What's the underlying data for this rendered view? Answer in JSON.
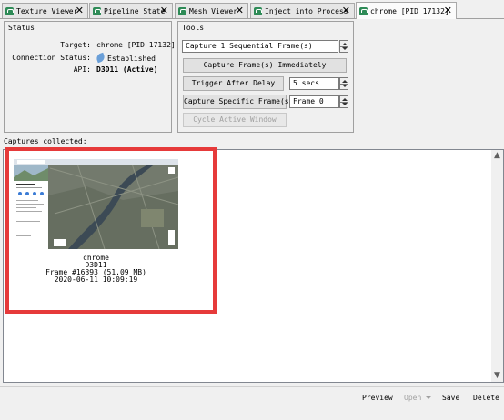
{
  "tabs": [
    {
      "label": "Texture Viewer",
      "active": false
    },
    {
      "label": "Pipeline State",
      "active": false
    },
    {
      "label": "Mesh Viewer",
      "active": false
    },
    {
      "label": "Inject into Process",
      "active": false
    },
    {
      "label": "chrome [PID 17132]",
      "active": true
    }
  ],
  "status": {
    "title": "Status",
    "target_label": "Target:",
    "target_value": "chrome [PID 17132]",
    "connection_label": "Connection Status:",
    "connection_value": "Established",
    "api_label": "API:",
    "api_value": "D3D11 (Active)"
  },
  "tools": {
    "title": "Tools",
    "sequential_value": "Capture 1 Sequential Frame(s)",
    "capture_now": "Capture Frame(s) Immediately",
    "trigger_delay": "Trigger After Delay",
    "delay_value": "5 secs",
    "capture_specific": "Capture Specific Frame(s):",
    "frame_value": "Frame 0",
    "cycle_window": "Cycle Active Window"
  },
  "captures": {
    "label": "Captures collected:",
    "items": [
      {
        "app": "chrome",
        "api": "D3D11",
        "frame": "Frame #16393 (51.09 MB)",
        "timestamp": "2020-06-11 10:09:19"
      }
    ]
  },
  "bottom": {
    "preview": "Preview",
    "open": "Open",
    "save": "Save",
    "delete": "Delete"
  },
  "colors": {
    "highlight": "#e63a3a",
    "tab_icon": "#2e8b57"
  }
}
